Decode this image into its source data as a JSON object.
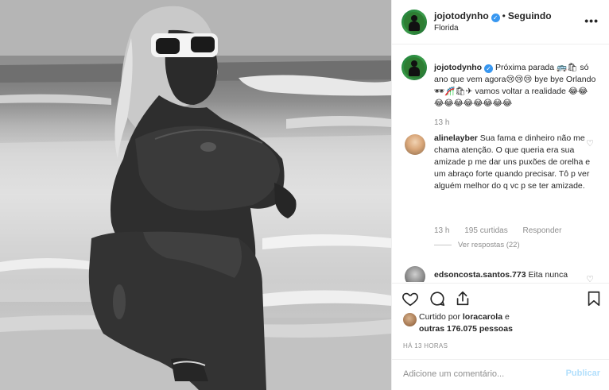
{
  "post": {
    "username": "jojotodynho",
    "separator": "•",
    "follow_label": "Seguindo",
    "location": "Florida",
    "more_icon": "more-dots-icon",
    "verified_icon": "✓"
  },
  "caption": {
    "username": "jojotodynho",
    "text": " Próxima parada 🚌🛍 só ano que vem agora😢😢😢 bye bye Orlando 🕶🎢🛍✈ vamos voltar a realidade 😂😂😂😂😂😂😂😂😂😂",
    "time": "13 h"
  },
  "comments": [
    {
      "username": "alinelayber",
      "text": " Sua fama e dinheiro não me chama atenção. O que queria era sua amizade p me dar uns puxões de orelha e um abraço forte quando precisar. Tô p ver alguém melhor do q vc p se ter amizade.",
      "time": "13 h",
      "likes": "195 curtidas",
      "reply": "Responder",
      "view_replies": "Ver respostas (22)"
    },
    {
      "username": "edsoncosta.santos.773",
      "text": " Eita nunca"
    }
  ],
  "actions": {
    "like_icon": "heart-icon",
    "comment_icon": "comment-icon",
    "share_icon": "share-icon",
    "save_icon": "bookmark-icon"
  },
  "likes": {
    "prefix": "Curtido por ",
    "user": "loracarola",
    "middle": " e",
    "others": "outras 176.075 pessoas"
  },
  "timestamp": "HÁ 13 HORAS",
  "add_comment": {
    "placeholder": "Adicione um comentário...",
    "post_label": "Publicar"
  }
}
